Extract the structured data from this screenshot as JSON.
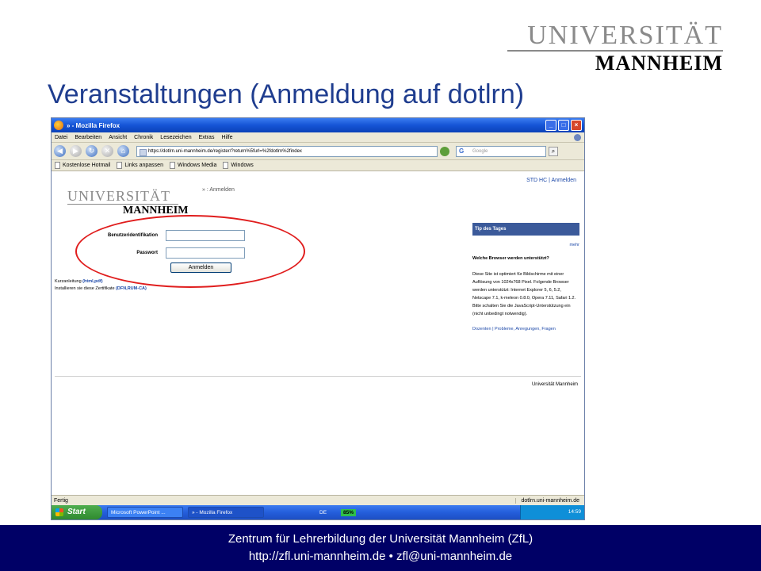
{
  "slide": {
    "logo_line1": "UNIVERSITÄT",
    "logo_line2": "MANNHEIM",
    "title": "Veranstaltungen (Anmeldung auf dotlrn)",
    "footer_line1": "Zentrum für Lehrerbildung der Universität Mannheim (ZfL)",
    "footer_line2": "http://zfl.uni-mannheim.de • zfl@uni-mannheim.de"
  },
  "browser": {
    "window_title": "» - Mozilla Firefox",
    "window_buttons": [
      "_",
      "□",
      "×"
    ],
    "menu": [
      "Datei",
      "Bearbeiten",
      "Ansicht",
      "Chronik",
      "Lesezeichen",
      "Extras",
      "Hilfe"
    ],
    "url": "https://dotlrn.uni-mannheim.de/register/?return%5furl=%2fdotlrn%2findex",
    "search_placeholder": "Google",
    "bookmarks": [
      "Kostenlose Hotmail",
      "Links anpassen",
      "Windows Media",
      "Windows"
    ],
    "status": "Fertig",
    "status_host": "dotlrn.uni-mannheim.de"
  },
  "page": {
    "logo_line1": "UNIVERSITÄT",
    "logo_line2": "MANNHEIM",
    "breadcrumb": "» : Anmelden",
    "top_links": "STD HC | Anmelden",
    "login": {
      "user_label": "Benutzeridentifikation",
      "password_label": "Passwort",
      "button_label": "Anmelden"
    },
    "info_line1_prefix": "Kurzanleitung",
    "info_line1_link": "(html,pdf)",
    "info_line2_prefix": "Installieren sie diese Zertifikate",
    "info_line2_link": "(DFN,RUM-CA)",
    "tip": {
      "header": "Tip des Tages",
      "more": "mehr",
      "question": "Welche Browser werden unterstützt?",
      "text": "Diese Site ist optimiert für Bildschirme mit einer Auflösung von 1024x768 Pixel. Folgende Browser werden unterstützt: Internet Explorer 5, 6, 5.2, Netscape 7.1, k-meleon 0.8.0, Opera 7.11, Safari 1.2. Bitte schalten Sie die JavaScript-Unterstützung ein (nicht unbedingt notwendig).",
      "links": "Dozenten | Probleme, Anregungen, Fragen"
    },
    "footer": "Universität Mannheim"
  },
  "taskbar": {
    "start": "Start",
    "tasks": [
      "Microsoft PowerPoint ...",
      "» - Mozilla Firefox"
    ],
    "language": "DE",
    "battery": "85%",
    "clock": "14:59"
  },
  "colors": {
    "title_blue": "#1f3d8f",
    "band": "#000066",
    "ellipse_red": "#e01d1d"
  }
}
